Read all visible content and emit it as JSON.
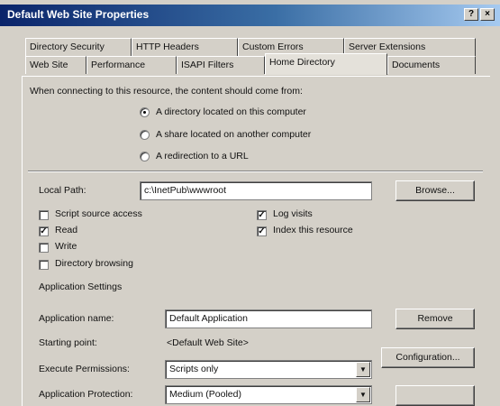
{
  "window": {
    "title": "Default Web Site Properties"
  },
  "titlebar_buttons": {
    "help": "?",
    "close": "×"
  },
  "tabs_row1": [
    "Directory Security",
    "HTTP Headers",
    "Custom Errors",
    "Server Extensions"
  ],
  "tabs_row2": [
    "Web Site",
    "Performance",
    "ISAPI Filters",
    "Home Directory",
    "Documents"
  ],
  "active_tab": "Home Directory",
  "source": {
    "prompt": "When connecting to this resource, the content should come from:",
    "options": [
      {
        "label": "A directory located on this computer",
        "selected": true
      },
      {
        "label": "A share located on another computer",
        "selected": false
      },
      {
        "label": "A redirection to a URL",
        "selected": false
      }
    ]
  },
  "local_path": {
    "label": "Local Path:",
    "value": "c:\\InetPub\\wwwroot",
    "browse": "Browse..."
  },
  "permissions": {
    "left": [
      {
        "label": "Script source access",
        "checked": false
      },
      {
        "label": "Read",
        "checked": true
      },
      {
        "label": "Write",
        "checked": false
      },
      {
        "label": "Directory browsing",
        "checked": false
      }
    ],
    "right": [
      {
        "label": "Log visits",
        "checked": true
      },
      {
        "label": "Index this resource",
        "checked": true
      }
    ]
  },
  "app_settings": {
    "heading": "Application Settings",
    "name_label": "Application name:",
    "name_value": "Default Application",
    "remove": "Remove",
    "starting_point_label": "Starting point:",
    "starting_point_value": "<Default Web Site>",
    "configuration": "Configuration...",
    "exec_label": "Execute Permissions:",
    "exec_value": "Scripts only",
    "protection_label": "Application Protection:",
    "protection_value": "Medium (Pooled)",
    "check_mark": "✓",
    "dropdown_arrow": "▼"
  }
}
